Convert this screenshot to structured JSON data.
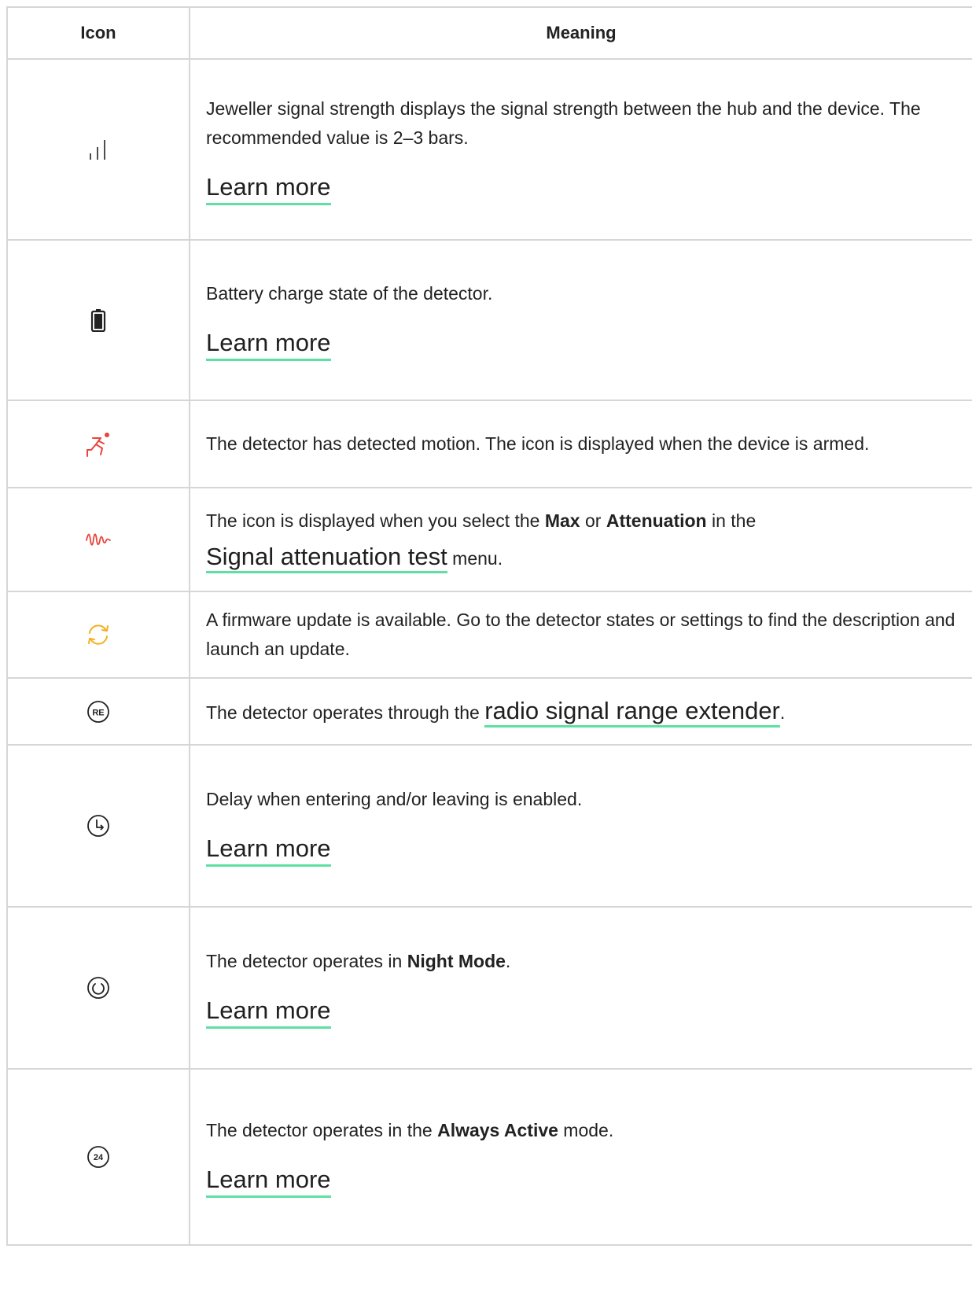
{
  "header": {
    "icon_col": "Icon",
    "meaning_col": "Meaning"
  },
  "rows": [
    {
      "icon": "signal-strength-icon",
      "text": "Jeweller signal strength displays the signal strength between the hub and the device. The recommended value is 2–3 bars.",
      "link": "Learn more"
    },
    {
      "icon": "battery-icon",
      "text": "Battery charge state of the detector.",
      "link": "Learn more"
    },
    {
      "icon": "motion-detected-icon",
      "text": "The detector has detected motion. The icon is displayed when the device is armed."
    },
    {
      "icon": "signal-wave-icon",
      "text_before": "The icon is displayed when you select the ",
      "bold1": "Max",
      "text_mid": " or ",
      "bold2": "Attenuation",
      "text_after": " in the ",
      "link": "Signal attenuation test",
      "text_end": " menu."
    },
    {
      "icon": "firmware-update-icon",
      "text": "A firmware update is available. Go to the detector states or settings to find the description and launch an update."
    },
    {
      "icon": "range-extender-icon",
      "icon_label": "RE",
      "text_before": "The detector operates through the ",
      "link": "radio signal range extender",
      "text_end": "."
    },
    {
      "icon": "delay-clock-icon",
      "text": "Delay when entering and/or leaving is enabled.",
      "link": "Learn more"
    },
    {
      "icon": "night-mode-icon",
      "text_before": "The detector operates in ",
      "bold": "Night Mode",
      "text_end": ".",
      "link": "Learn more"
    },
    {
      "icon": "always-active-icon",
      "icon_label": "24",
      "text_before": "The detector operates in the ",
      "bold": "Always Active",
      "text_end": " mode.",
      "link": "Learn more"
    }
  ],
  "colors": {
    "border": "#d6d6d6",
    "link_underline": "#5ee0a3",
    "alert_red": "#e8453c",
    "update_yellow": "#f2b01e"
  }
}
